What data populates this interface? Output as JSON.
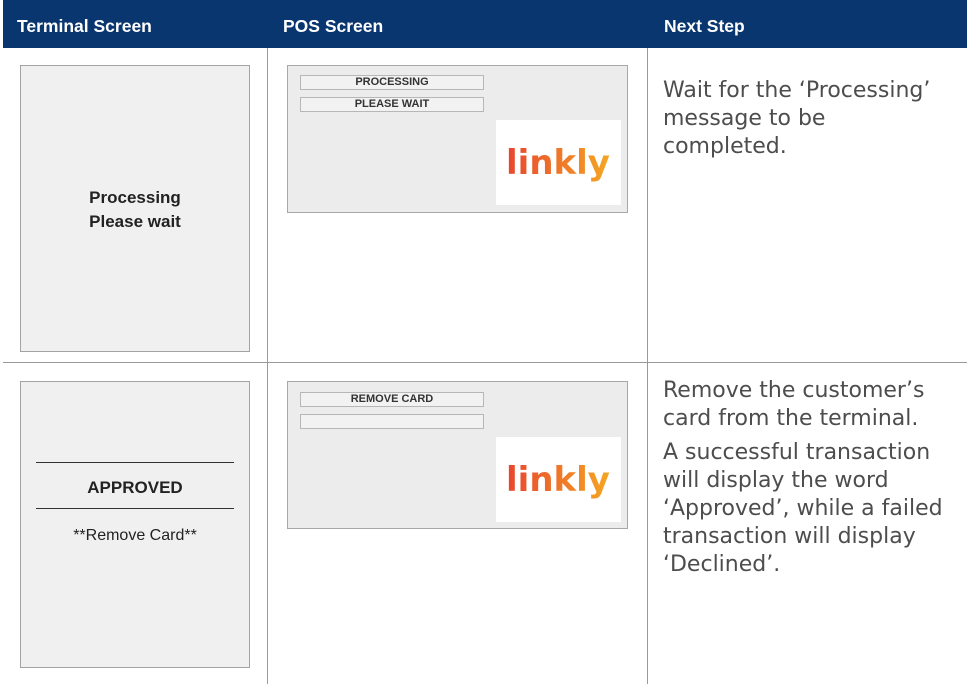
{
  "headers": {
    "terminal": "Terminal Screen",
    "pos": "POS Screen",
    "next": "Next Step"
  },
  "rows": [
    {
      "terminal": {
        "line1": "Processing",
        "line2": "Please wait"
      },
      "pos": {
        "field1": "PROCESSING",
        "field2": "PLEASE WAIT",
        "logo": "linkly"
      },
      "next": [
        "Wait for the ‘Processing’ message to be completed."
      ]
    },
    {
      "terminal": {
        "status": "APPROVED",
        "instruction": "**Remove Card**"
      },
      "pos": {
        "field1": "REMOVE CARD",
        "field2": "",
        "logo": "linkly"
      },
      "next": [
        "Remove the customer’s card from the terminal.",
        "A successful transaction will display the word ‘Approved’, while a failed transaction will display ‘Declined’."
      ]
    }
  ],
  "colors": {
    "header_bg": "#0a3670",
    "logo_gradient_start": "#e8452f",
    "logo_gradient_end": "#f5a623"
  }
}
